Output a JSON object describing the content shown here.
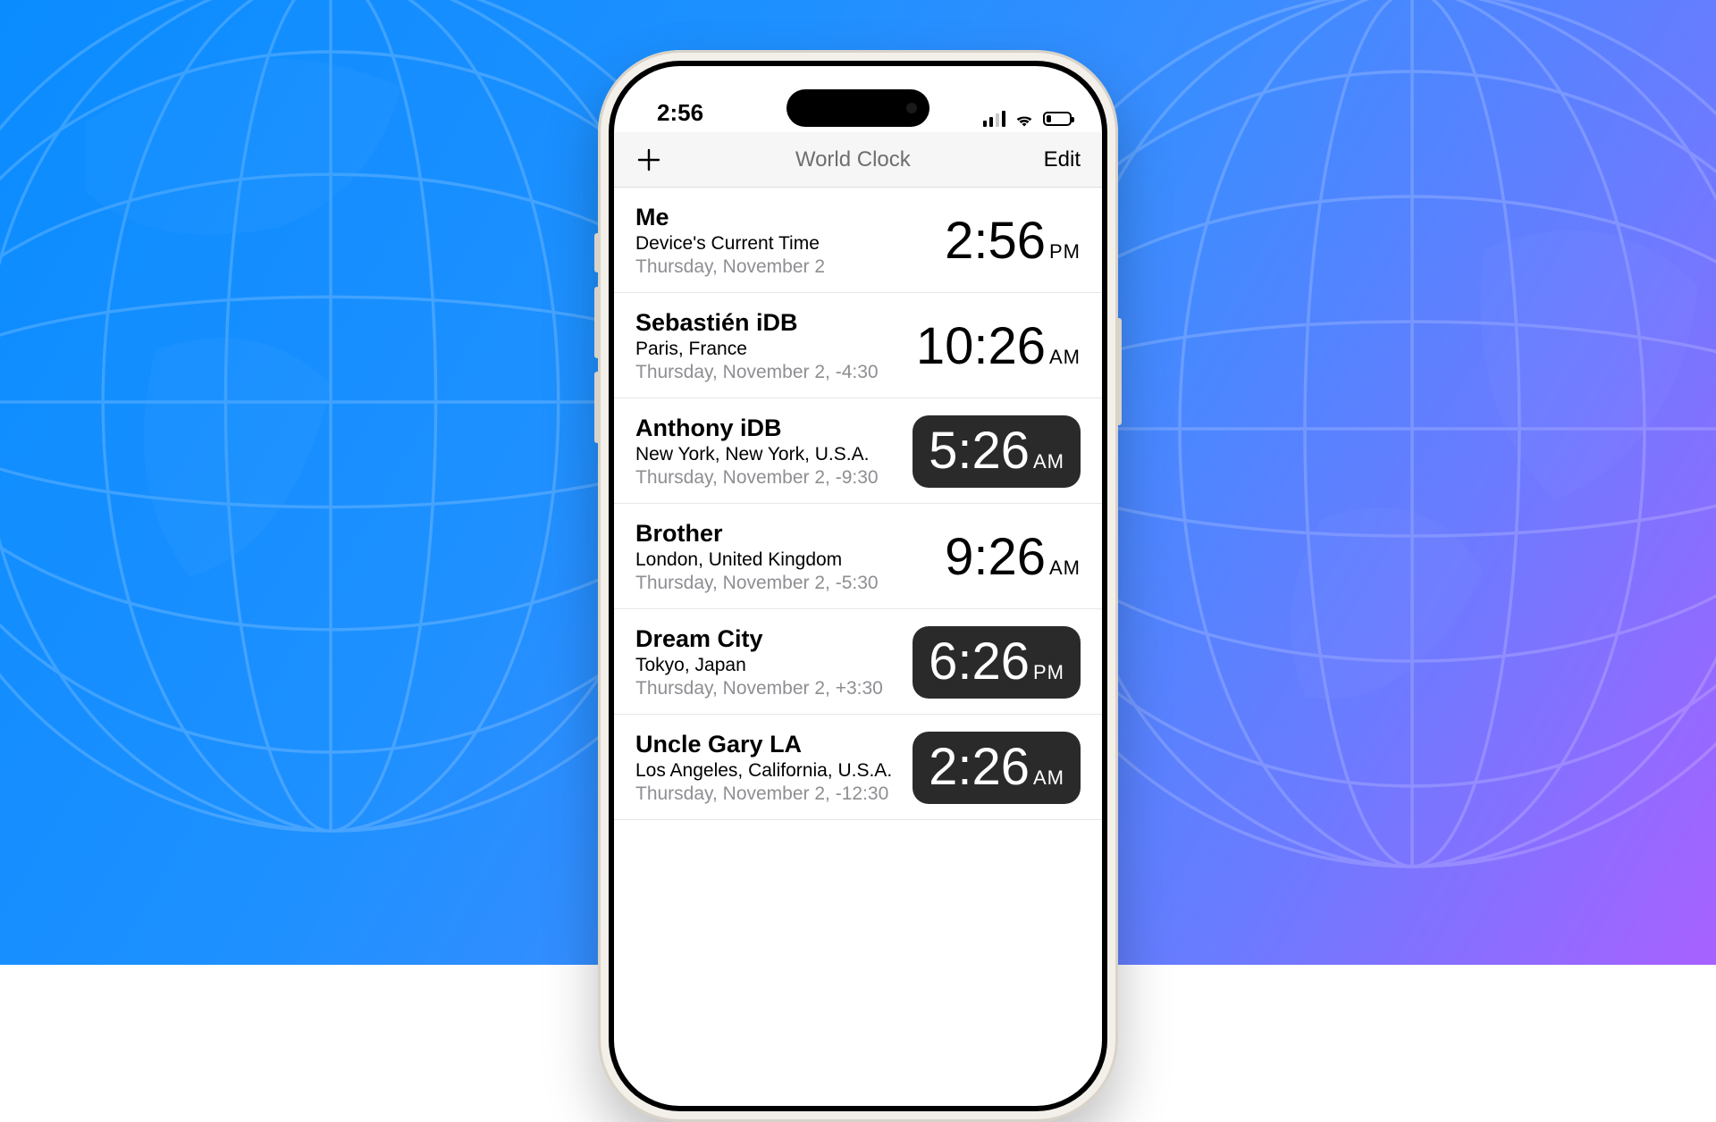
{
  "statusbar": {
    "time": "2:56"
  },
  "navbar": {
    "title": "World Clock",
    "edit": "Edit"
  },
  "rows": [
    {
      "name": "Me",
      "location": "Device's Current Time",
      "detail": "Thursday, November 2",
      "time": "2:56",
      "ampm": "PM",
      "dark": false
    },
    {
      "name": "Sebastién iDB",
      "location": "Paris, France",
      "detail": "Thursday, November 2, -4:30",
      "time": "10:26",
      "ampm": "AM",
      "dark": false
    },
    {
      "name": "Anthony iDB",
      "location": "New York, New York, U.S.A.",
      "detail": "Thursday, November 2, -9:30",
      "time": "5:26",
      "ampm": "AM",
      "dark": true
    },
    {
      "name": "Brother",
      "location": "London, United Kingdom",
      "detail": "Thursday, November 2, -5:30",
      "time": "9:26",
      "ampm": "AM",
      "dark": false
    },
    {
      "name": "Dream City",
      "location": "Tokyo, Japan",
      "detail": "Thursday, November 2, +3:30",
      "time": "6:26",
      "ampm": "PM",
      "dark": true
    },
    {
      "name": "Uncle Gary LA",
      "location": "Los Angeles, California, U.S.A.",
      "detail": "Thursday, November 2, -12:30",
      "time": "2:26",
      "ampm": "AM",
      "dark": true
    }
  ]
}
